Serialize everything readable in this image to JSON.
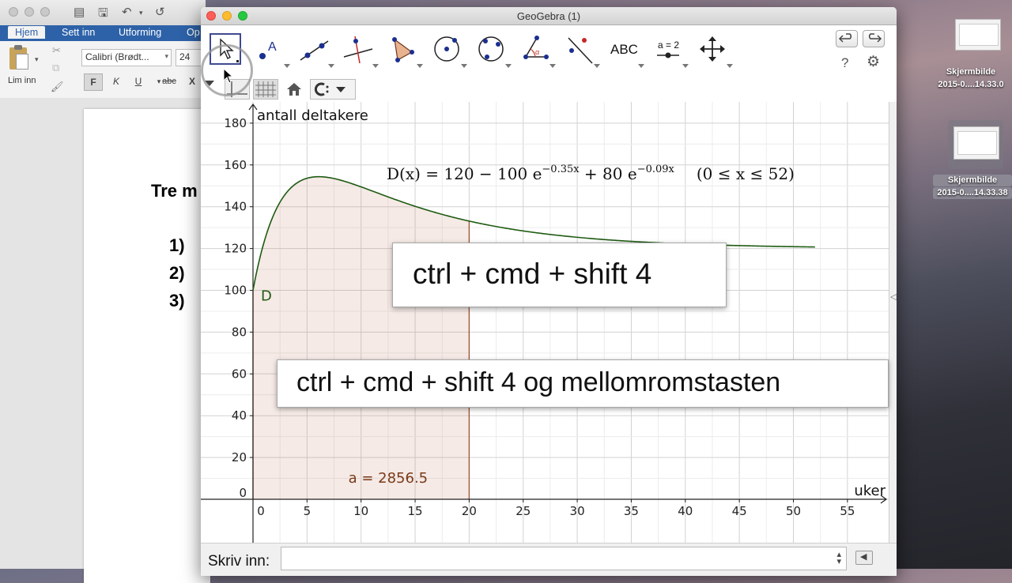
{
  "word": {
    "tabs": [
      "Hjem",
      "Sett inn",
      "Utforming",
      "Op"
    ],
    "paste_label": "Lim inn",
    "font_name": "Calibri (Brødt...",
    "font_size": "24",
    "format_buttons": [
      "F",
      "K",
      "U",
      "abc",
      "X"
    ],
    "doc_heading": "Tre m",
    "doc_items": [
      "1)",
      "2)",
      "3)"
    ]
  },
  "desktop": {
    "file1": {
      "line1": "Skjermbilde",
      "line2": "2015-0....14.33.0"
    },
    "file2": {
      "line1": "Skjermbilde",
      "line2": "2015-0....14.33.38"
    }
  },
  "geogebra": {
    "title": "GeoGebra (1)",
    "tools": [
      "move-tool",
      "point-tool",
      "line-tool",
      "perpendicular-tool",
      "polygon-tool",
      "circle-tool",
      "conic-tool",
      "angle-tool",
      "reflect-tool",
      "text-tool",
      "slider-tool",
      "move-view-tool"
    ],
    "text_tool_label": "ABC",
    "slider_tool_label": "a = 2",
    "help_label": "?",
    "input_label": "Skriv inn:",
    "input_value": ""
  },
  "graph": {
    "y_axis_label": "antall deltakere",
    "x_axis_label": "uker",
    "function_label": "D",
    "formula": {
      "lhs": "D(x)  =  120 − 100 e",
      "exp1": "−0.35x",
      "mid": " + 80 e",
      "exp2": "−0.09x",
      "domain": "(0 ≤ x ≤ 52)"
    },
    "area_label": "a = 2856.5"
  },
  "chart_data": {
    "type": "line",
    "title": "",
    "xlabel": "uker",
    "ylabel": "antall deltakere",
    "xlim": [
      0,
      57
    ],
    "ylim": [
      0,
      185
    ],
    "x_ticks": [
      0,
      5,
      10,
      15,
      20,
      25,
      30,
      35,
      40,
      45,
      50,
      55
    ],
    "y_ticks": [
      0,
      20,
      40,
      60,
      80,
      100,
      120,
      140,
      160,
      180
    ],
    "grid": true,
    "series": [
      {
        "name": "D",
        "function": "120 - 100*exp(-0.35x) + 80*exp(-0.09x)",
        "domain": [
          0,
          52
        ],
        "color": "#1f5b12"
      }
    ],
    "shaded_area": {
      "from": 0,
      "to": 20,
      "label": "a = 2856.5",
      "color": "#8b3a1a"
    }
  },
  "overlays": {
    "shortcut1": "ctrl + cmd + shift 4",
    "shortcut2": "ctrl + cmd + shift 4 og mellomromstasten"
  }
}
